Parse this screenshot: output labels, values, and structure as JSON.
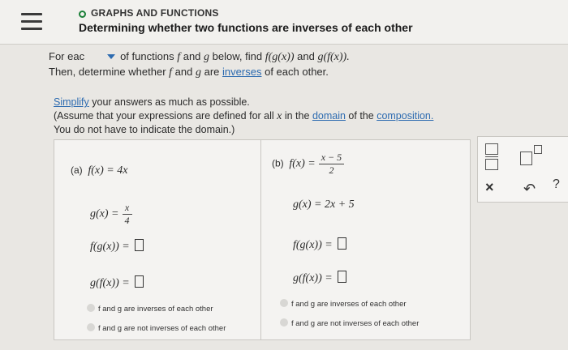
{
  "header": {
    "topic": "GRAPHS AND FUNCTIONS",
    "title": "Determining whether two functions are inverses of each other"
  },
  "question": {
    "line1_prefix": "For eac",
    "line1_mid": "of functions",
    "f": "f",
    "and": "and",
    "g": "g",
    "below_find": "below, find",
    "fgx": "f(g(x))",
    "and2": "and",
    "gfx": "g(f(x)).",
    "line2_a": "Then, determine whether",
    "line2_b": "are",
    "inverses": "inverses",
    "line2_c": "of each other."
  },
  "instructions": {
    "simplify": "Simplify",
    "simplify_rest": "your answers as much as possible.",
    "assume_a": "(Assume that your expressions are defined for all",
    "x": "x",
    "assume_b": "in the",
    "domain": "domain",
    "assume_c": "of the",
    "composition": "composition.",
    "no_domain": "You do not have to indicate the domain.)"
  },
  "part_a": {
    "label": "(a)",
    "f_def": "f(x) = 4x",
    "g_prefix": "g(x) =",
    "g_num": "x",
    "g_den": "4",
    "fg": "f(g(x)) =",
    "gf": "g(f(x)) =",
    "opt1": "f and g are inverses of each other",
    "opt2": "f and g are not inverses of each other"
  },
  "part_b": {
    "label": "(b)",
    "f_prefix": "f(x) =",
    "f_num": "x − 5",
    "f_den": "2",
    "g_def": "g(x) = 2x + 5",
    "fg": "f(g(x)) =",
    "gf": "g(f(x)) =",
    "opt1": "f and g are inverses of each other",
    "opt2": "f and g are not inverses of each other"
  },
  "tools": {
    "clear": "×",
    "undo": "↶",
    "help": "?"
  }
}
